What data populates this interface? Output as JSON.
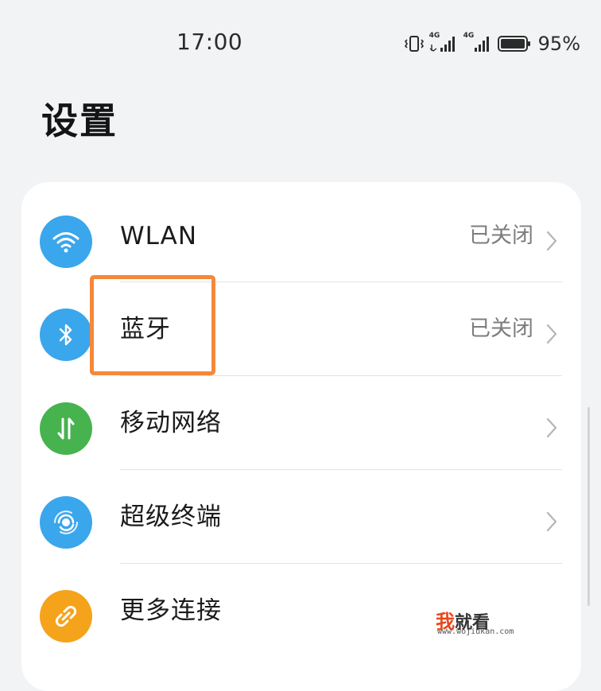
{
  "status_bar": {
    "time": "17:00",
    "battery": "95%",
    "icons": [
      "vibrate-icon",
      "signal-4g-icon",
      "signal-4g-icon",
      "battery-icon"
    ],
    "network_labels": [
      "4G",
      "4G"
    ]
  },
  "page": {
    "title": "设置"
  },
  "settings": {
    "items": [
      {
        "label": "WLAN",
        "status": "已关闭",
        "icon": "wifi-icon",
        "icon_color": "#3aa6ec"
      },
      {
        "label": "蓝牙",
        "status": "已关闭",
        "icon": "bluetooth-icon",
        "icon_color": "#3aa6ec"
      },
      {
        "label": "移动网络",
        "status": "",
        "icon": "mobile-data-icon",
        "icon_color": "#47b34f"
      },
      {
        "label": "超级终端",
        "status": "",
        "icon": "super-device-icon",
        "icon_color": "#3aa6ec"
      },
      {
        "label": "更多连接",
        "status": "",
        "icon": "link-icon",
        "icon_color": "#f5a31a"
      }
    ]
  },
  "annotation": {
    "highlight_color": "#f5883a"
  },
  "watermark": {
    "first_char": "我",
    "rest": "就看",
    "url": "www.wojiukan.com"
  }
}
